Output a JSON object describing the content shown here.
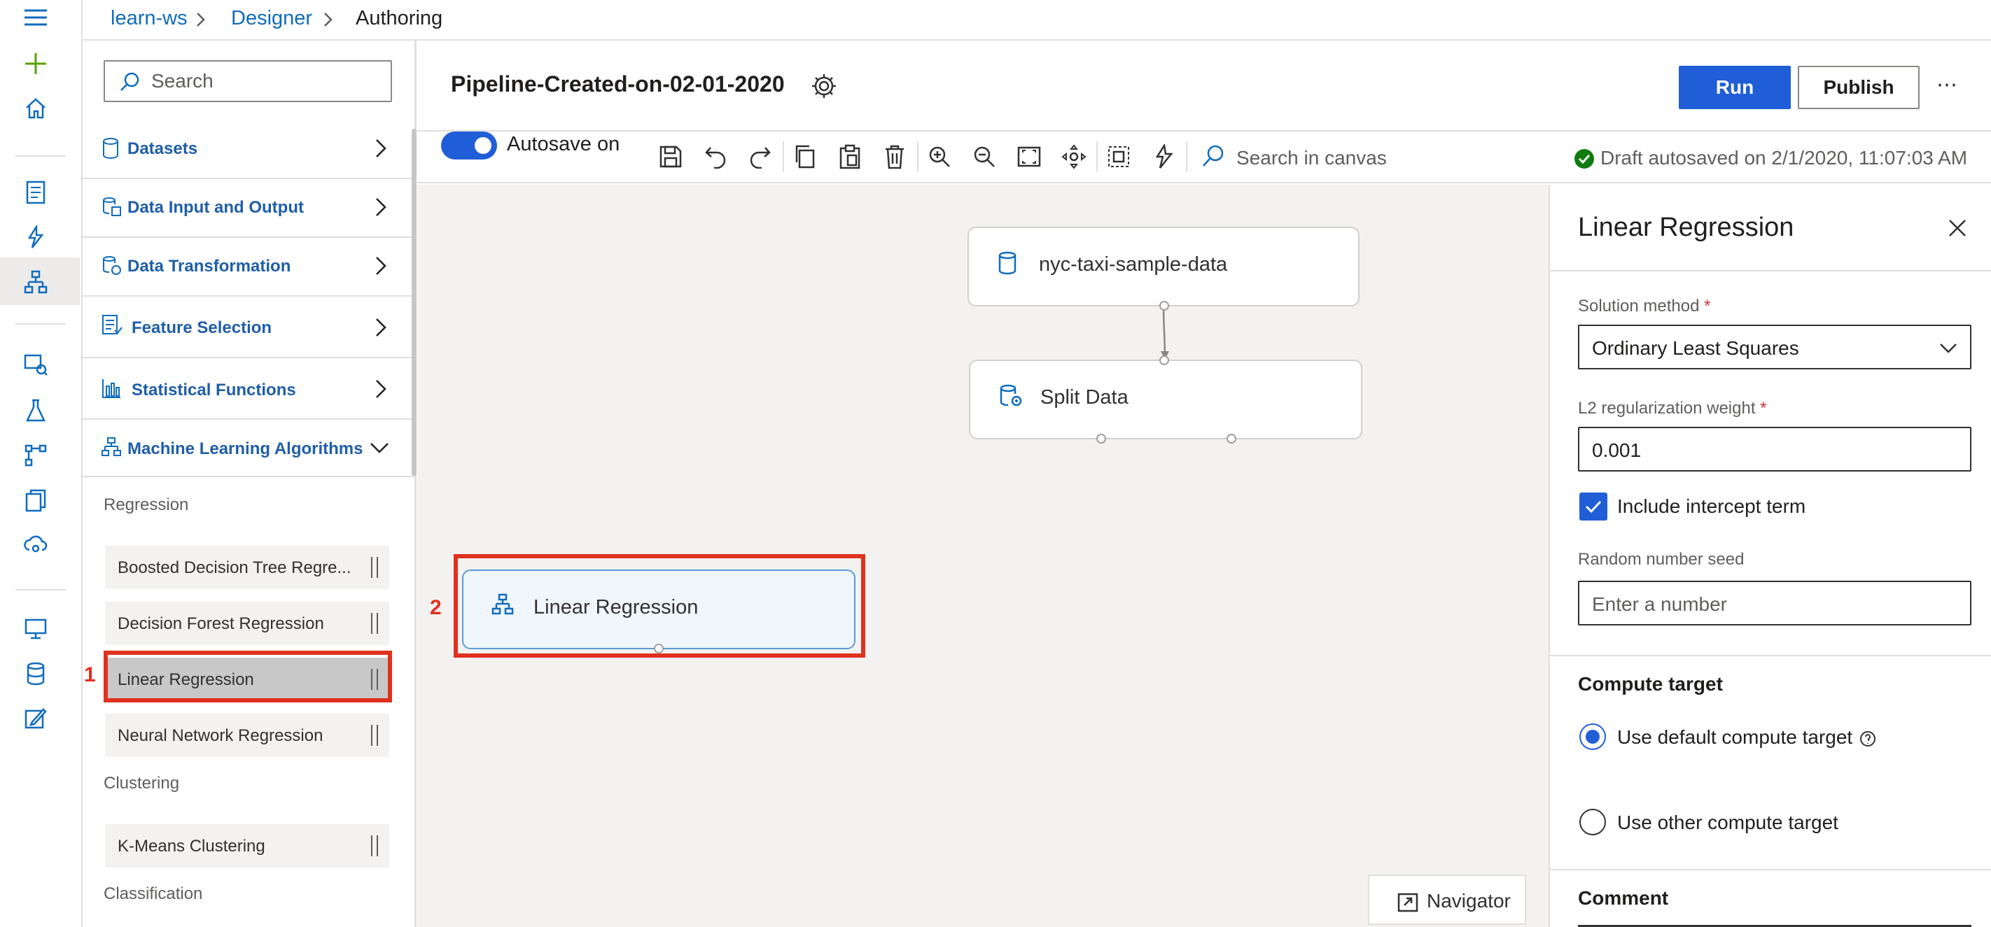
{
  "breadcrumb": {
    "workspace": "learn-ws",
    "designer": "Designer",
    "current": "Authoring"
  },
  "palette": {
    "search_placeholder": "Search",
    "categories": [
      {
        "label": "Datasets",
        "icon": "database-icon",
        "expanded": false
      },
      {
        "label": "Data Input and Output",
        "icon": "data-io-icon",
        "expanded": false
      },
      {
        "label": "Data Transformation",
        "icon": "data-transform-icon",
        "expanded": false
      },
      {
        "label": "Feature Selection",
        "icon": "feature-selection-icon",
        "expanded": false
      },
      {
        "label": "Statistical Functions",
        "icon": "bar-chart-icon",
        "expanded": false
      },
      {
        "label": "Machine Learning Algorithms",
        "icon": "hierarchy-icon",
        "expanded": true
      }
    ],
    "groups": {
      "regression": "Regression",
      "clustering": "Clustering",
      "classification": "Classification"
    },
    "modules": [
      {
        "label": "Boosted Decision Tree Regre..."
      },
      {
        "label": "Decision Forest Regression"
      },
      {
        "label": "Linear Regression"
      },
      {
        "label": "Neural Network Regression"
      },
      {
        "label": "K-Means Clustering"
      }
    ]
  },
  "header": {
    "title": "Pipeline-Created-on-02-01-2020",
    "run_label": "Run",
    "publish_label": "Publish",
    "more": "⋯"
  },
  "toolbar": {
    "autosave_label": "Autosave on",
    "autosave_on": true,
    "search_placeholder": "Search in canvas",
    "status": "Draft autosaved on 2/1/2020, 11:07:03 AM"
  },
  "canvas": {
    "nodes": [
      {
        "label": "nyc-taxi-sample-data",
        "icon": "dataset-icon"
      },
      {
        "label": "Split Data",
        "icon": "split-data-icon"
      },
      {
        "label": "Linear Regression",
        "icon": "hierarchy-icon"
      }
    ],
    "annotations": [
      "1",
      "2"
    ],
    "navigator_label": "Navigator"
  },
  "properties": {
    "title": "Linear Regression",
    "solution_method_label": "Solution method",
    "solution_method_value": "Ordinary Least Squares",
    "l2_label": "L2 regularization weight",
    "l2_value": "0.001",
    "intercept_label": "Include intercept term",
    "intercept_checked": true,
    "seed_label": "Random number seed",
    "seed_placeholder": "Enter a number",
    "compute_title": "Compute target",
    "compute_default_label": "Use default compute target",
    "compute_other_label": "Use other compute target",
    "compute_selected": "default",
    "comment_title": "Comment",
    "required_mark": "*"
  },
  "colors": {
    "accent": "#1f5ed6",
    "link": "#0f6cbd",
    "highlight": "#e0301e",
    "success": "#107c10"
  }
}
